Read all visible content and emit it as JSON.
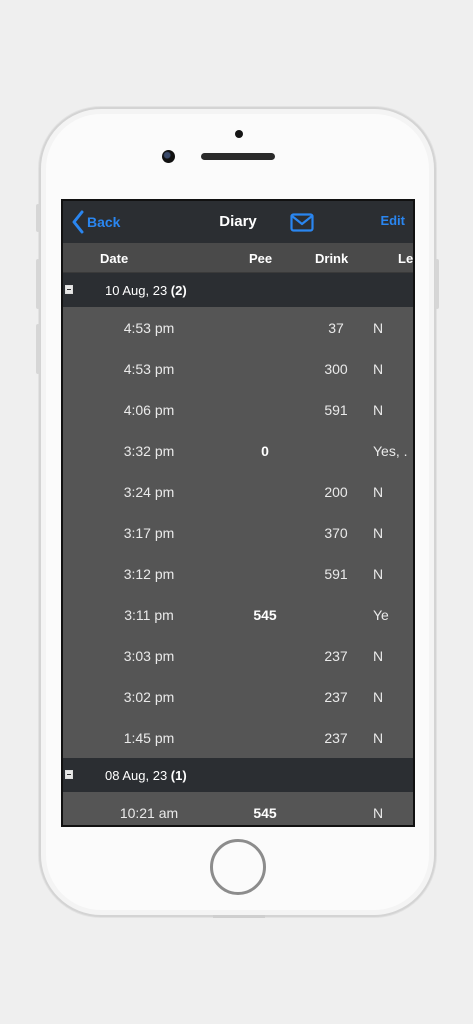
{
  "navbar": {
    "back_label": "Back",
    "title": "Diary",
    "edit_label": "Edit"
  },
  "columns": {
    "date": "Date",
    "pee": "Pee",
    "drink": "Drink",
    "leak": "Le"
  },
  "sections": [
    {
      "date": "10 Aug, 23",
      "count": "(2)",
      "rows": [
        {
          "time": "4:53 pm",
          "pee": "",
          "drink": "37",
          "leak": "N"
        },
        {
          "time": "4:53 pm",
          "pee": "",
          "drink": "300",
          "leak": "N"
        },
        {
          "time": "4:06 pm",
          "pee": "",
          "drink": "591",
          "leak": "N"
        },
        {
          "time": "3:32 pm",
          "pee": "0",
          "drink": "",
          "leak": "Yes, ."
        },
        {
          "time": "3:24 pm",
          "pee": "",
          "drink": "200",
          "leak": "N"
        },
        {
          "time": "3:17 pm",
          "pee": "",
          "drink": "370",
          "leak": "N"
        },
        {
          "time": "3:12 pm",
          "pee": "",
          "drink": "591",
          "leak": "N"
        },
        {
          "time": "3:11 pm",
          "pee": "545",
          "drink": "",
          "leak": "Ye"
        },
        {
          "time": "3:03 pm",
          "pee": "",
          "drink": "237",
          "leak": "N"
        },
        {
          "time": "3:02 pm",
          "pee": "",
          "drink": "237",
          "leak": "N"
        },
        {
          "time": "1:45 pm",
          "pee": "",
          "drink": "237",
          "leak": "N"
        }
      ]
    },
    {
      "date": "08 Aug, 23",
      "count": "(1)",
      "rows": [
        {
          "time": "10:21 am",
          "pee": "545",
          "drink": "",
          "leak": "N"
        }
      ]
    }
  ]
}
